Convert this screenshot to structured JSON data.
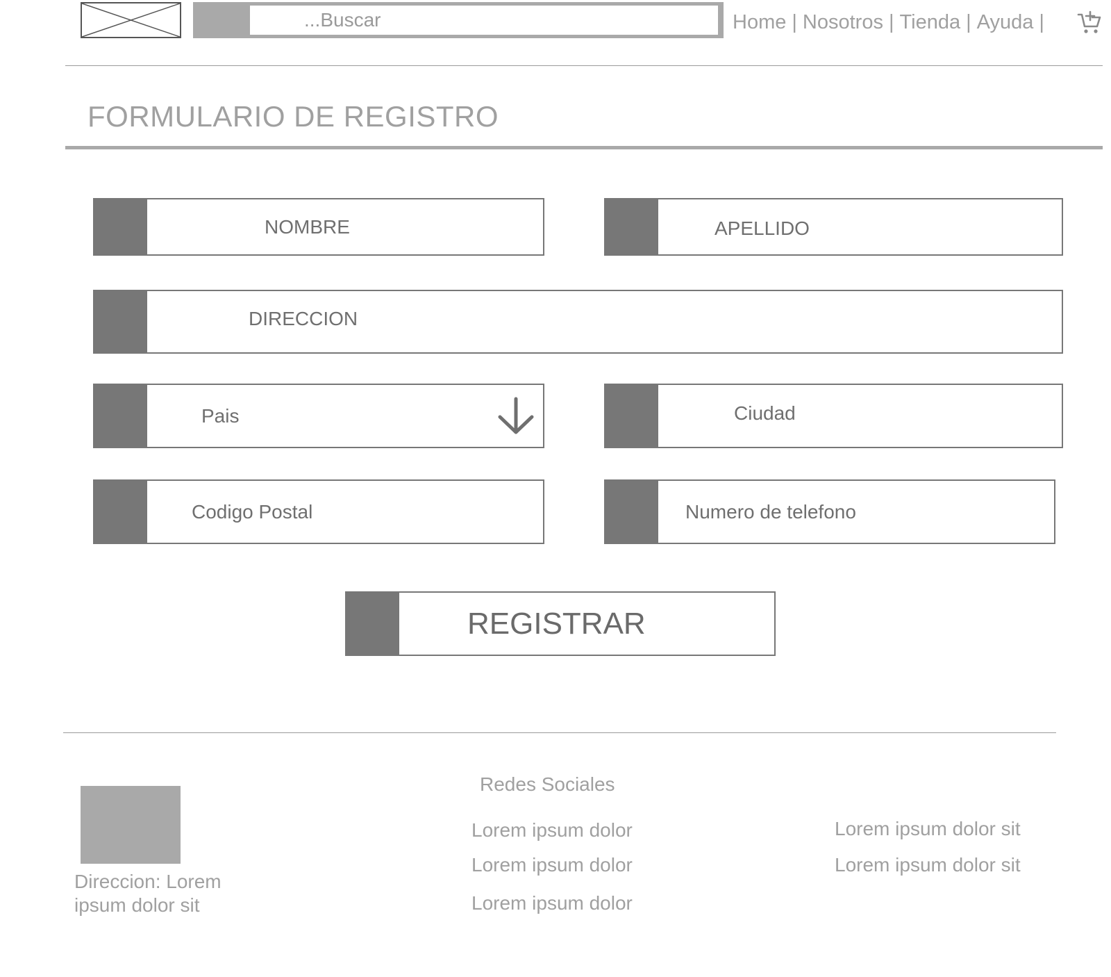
{
  "header": {
    "search": {
      "placeholder": "...Buscar"
    },
    "nav": [
      "Home",
      "Nosotros",
      "Tienda",
      "Ayuda"
    ],
    "nav_separator": "|"
  },
  "page_title": "FORMULARIO DE REGISTRO",
  "form": {
    "nombre": "NOMBRE",
    "apellido": "APELLIDO",
    "direccion": "DIRECCION",
    "pais": "Pais",
    "ciudad": "Ciudad",
    "codigo_postal": "Codigo Postal",
    "telefono": "Numero de telefono",
    "submit": "REGISTRAR"
  },
  "footer": {
    "address": "Direccion: Lorem ipsum dolor sit",
    "social_title": "Redes Sociales",
    "links_col1": [
      "Lorem ipsum dolor",
      "Lorem ipsum dolor",
      "Lorem ipsum dolor"
    ],
    "links_col2": [
      "Lorem ipsum dolor sit",
      "Lorem ipsum dolor sit"
    ]
  },
  "colors": {
    "field_tab": "#777777",
    "rule": "#a9a9a9",
    "muted_text": "#a0a0a0"
  },
  "icons": {
    "logo": "image-placeholder-icon",
    "cart": "add-to-cart-icon",
    "pais_dropdown": "arrow-down-icon"
  }
}
